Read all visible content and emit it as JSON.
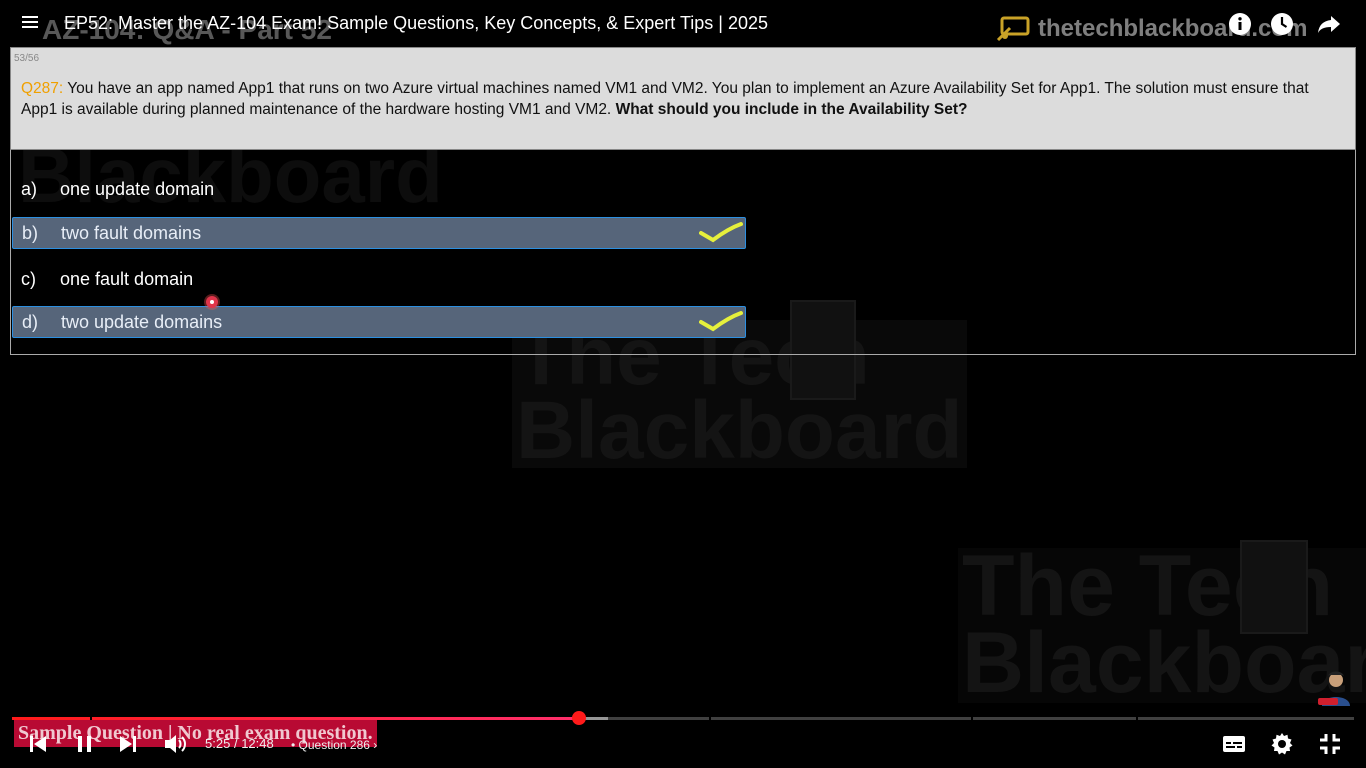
{
  "header": {
    "video_title": "EP52: Master the AZ-104 Exam! Sample Questions, Key Concepts, & Expert Tips | 2025",
    "overlay_title": "AZ-104: Q&A - Part 52",
    "brand": "thetechblackboard.com"
  },
  "question": {
    "counter": "53/56",
    "number": "Q287:",
    "text": "You have an app named App1 that runs on two Azure virtual machines named VM1 and VM2. You plan to implement an Azure Availability Set for App1. The solution must ensure that App1 is available during planned maintenance of the hardware hosting VM1 and VM2.",
    "prompt": "What should you include in the Availability Set?"
  },
  "options": [
    {
      "letter": "a)",
      "text": "one update domain",
      "correct": false
    },
    {
      "letter": "b)",
      "text": "two fault domains",
      "correct": true
    },
    {
      "letter": "c)",
      "text": "one fault domain",
      "correct": false
    },
    {
      "letter": "d)",
      "text": "two update domains",
      "correct": true
    }
  ],
  "watermarks": {
    "top": "Blackboard",
    "center_line1": "The Tech",
    "center_line2": "Blackboard",
    "br_line1": "The Tech",
    "br_line2": "Blackboard"
  },
  "player": {
    "caption": "Sample Question | No real exam question.",
    "time_current": "5:25",
    "time_separator": "/",
    "time_total": "12:48",
    "chapter": "Question 286",
    "progress": 0.4225,
    "buffered": 0.444
  },
  "colors": {
    "accent": "#ff1a1a",
    "question_number": "#f0a000",
    "correct_bg": "#56657a",
    "correct_border": "#2c8fe0",
    "checkmark": "#e6f03c"
  }
}
